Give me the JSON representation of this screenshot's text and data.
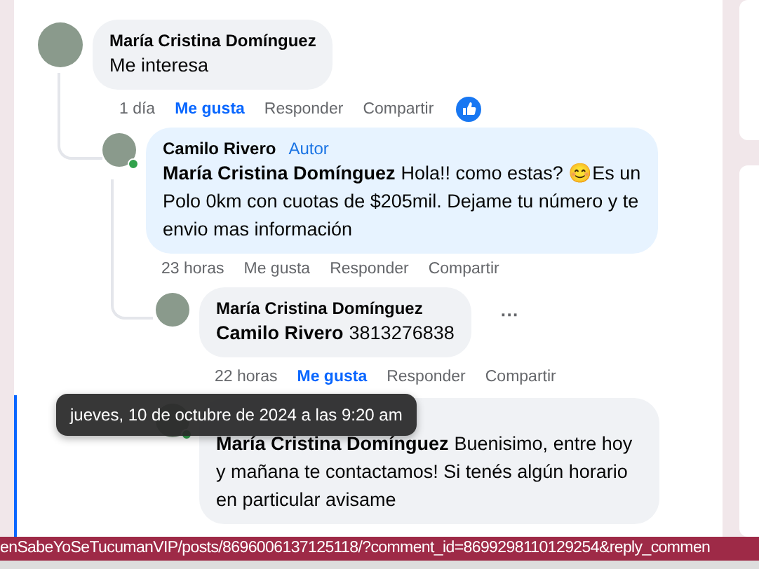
{
  "comments": [
    {
      "author": "María Cristina Domínguez",
      "text": "Me interesa",
      "online": false,
      "time": "1 día",
      "liked": true,
      "like_label": "Me gusta",
      "reply_label": "Responder",
      "share_label": "Compartir",
      "reacted": true,
      "children": [
        {
          "author": "Camilo Rivero",
          "badge": "Autor",
          "mention": "María Cristina Domínguez",
          "text": "Hola!! como estas? 😊Es un Polo 0km con cuotas de $205mil. Dejame tu número y te envio mas información",
          "online": true,
          "time": "23 horas",
          "liked": false,
          "like_label": "Me gusta",
          "reply_label": "Responder",
          "share_label": "Compartir",
          "children": [
            {
              "author": "María Cristina Domínguez",
              "mention": "Camilo Rivero",
              "text": "3813276838",
              "online": false,
              "more": "···",
              "time": "22 horas",
              "liked": true,
              "like_label": "Me gusta",
              "reply_label": "Responder",
              "share_label": "Compartir"
            },
            {
              "mention": "María Cristina Domínguez",
              "text": "Buenisimo, entre hoy y mañana te contactamos! Si tenés algún horario en particular avisame",
              "online": true
            }
          ]
        }
      ]
    }
  ],
  "tooltip": "jueves, 10 de octubre de 2024 a las 9:20 am",
  "status_bar": "enSabeYoSeTucumanVIP/posts/8696006137125118/?comment_id=8699298110129254&reply_commen"
}
